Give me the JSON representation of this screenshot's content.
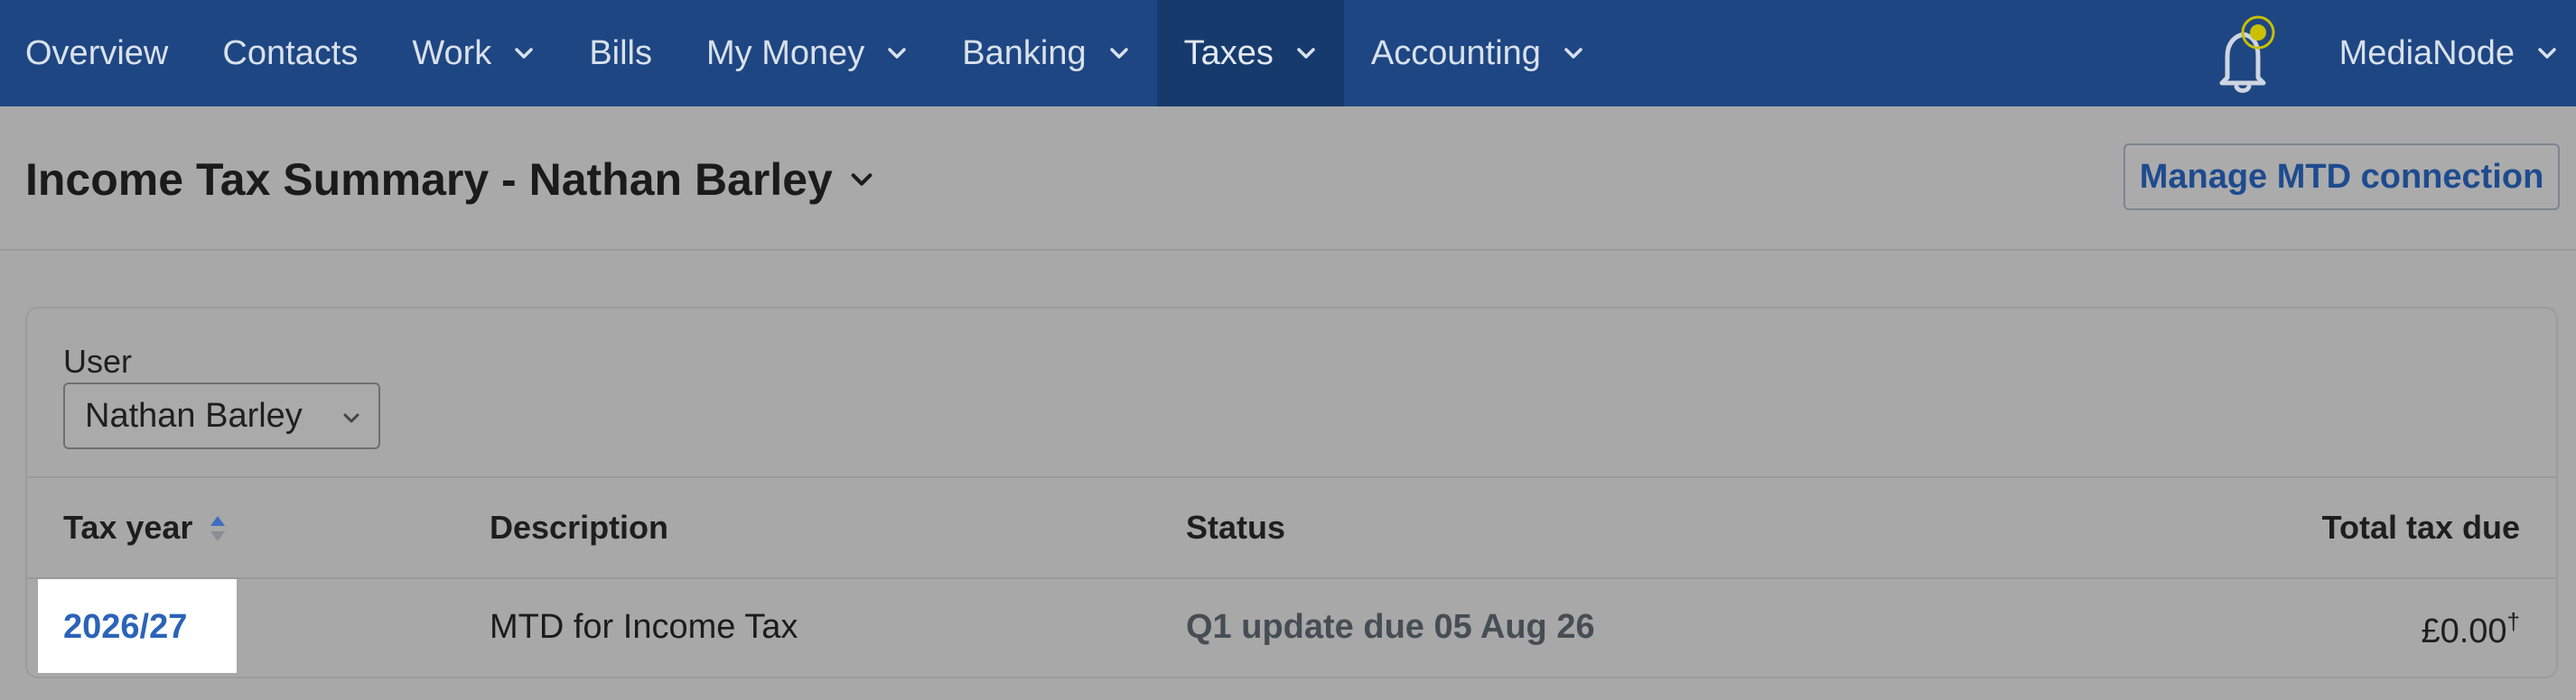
{
  "nav": {
    "items": [
      {
        "label": "Overview",
        "dropdown": false
      },
      {
        "label": "Contacts",
        "dropdown": false
      },
      {
        "label": "Work",
        "dropdown": true
      },
      {
        "label": "Bills",
        "dropdown": false
      },
      {
        "label": "My Money",
        "dropdown": true
      },
      {
        "label": "Banking",
        "dropdown": true
      },
      {
        "label": "Taxes",
        "dropdown": true,
        "active": true
      },
      {
        "label": "Accounting",
        "dropdown": true
      }
    ],
    "account_label": "MediaNode",
    "notification_icon": "bell-icon"
  },
  "header": {
    "title": "Income Tax Summary - Nathan Barley",
    "manage_button": "Manage MTD connection"
  },
  "filter": {
    "user_label": "User",
    "user_selected": "Nathan Barley"
  },
  "table": {
    "columns": [
      "Tax year",
      "Description",
      "Status",
      "Total tax due"
    ],
    "rows": [
      {
        "tax_year": "2026/27",
        "description": "MTD for Income Tax",
        "status": "Q1 update due 05 Aug 26",
        "total_tax_due": "£0.00",
        "total_marker": "†"
      }
    ]
  },
  "colors": {
    "nav_bg": "#1e4682",
    "nav_active_bg": "#173a6c",
    "link": "#2b63b8",
    "notification_dot": "#c8c000"
  }
}
